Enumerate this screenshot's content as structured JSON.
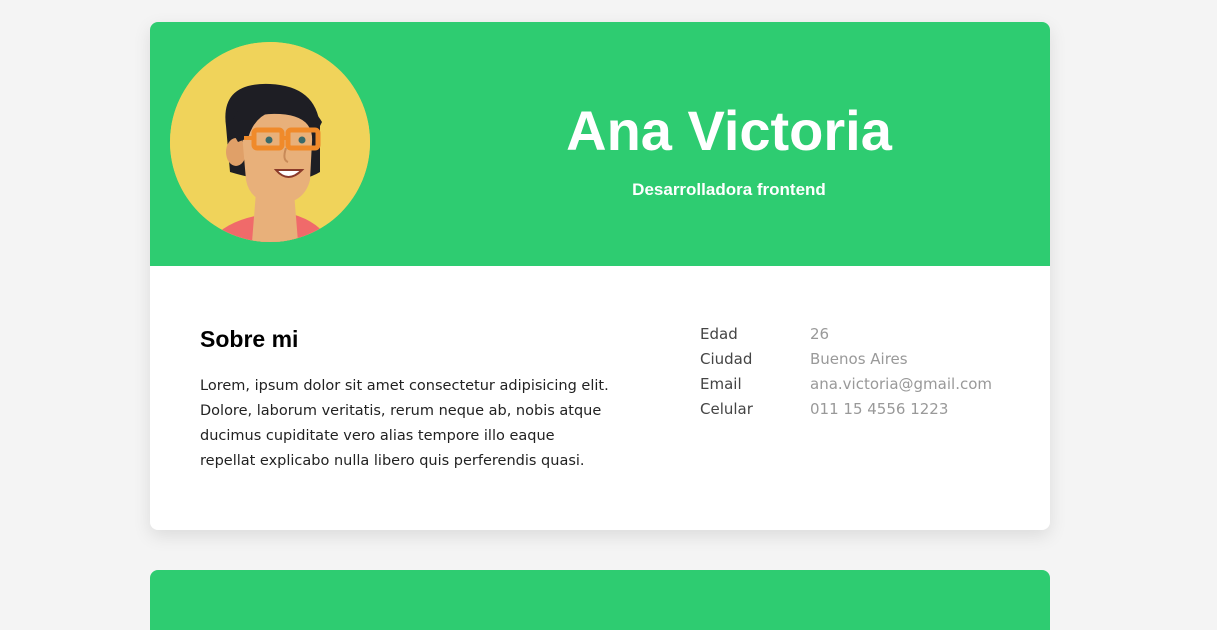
{
  "profile": {
    "name": "Ana Victoria",
    "role": "Desarrolladora frontend",
    "avatar_icon": "woman-with-glasses-avatar"
  },
  "about": {
    "title": "Sobre mi",
    "text": "Lorem, ipsum dolor sit amet consectetur adipisicing elit. Dolore, laborum veritatis, rerum neque ab, nobis atque ducimus cupiditate vero alias tempore illo eaque repellat explicabo nulla libero quis perferendis quasi."
  },
  "info": [
    {
      "label": "Edad",
      "value": "26"
    },
    {
      "label": "Ciudad",
      "value": "Buenos Aires"
    },
    {
      "label": "Email",
      "value": "ana.victoria@gmail.com"
    },
    {
      "label": "Celular",
      "value": "011 15 4556 1223"
    }
  ],
  "colors": {
    "header_green": "#2ecc71",
    "avatar_background": "#f0d35a",
    "page_background": "#f4f4f4",
    "value_gray": "#999999"
  }
}
